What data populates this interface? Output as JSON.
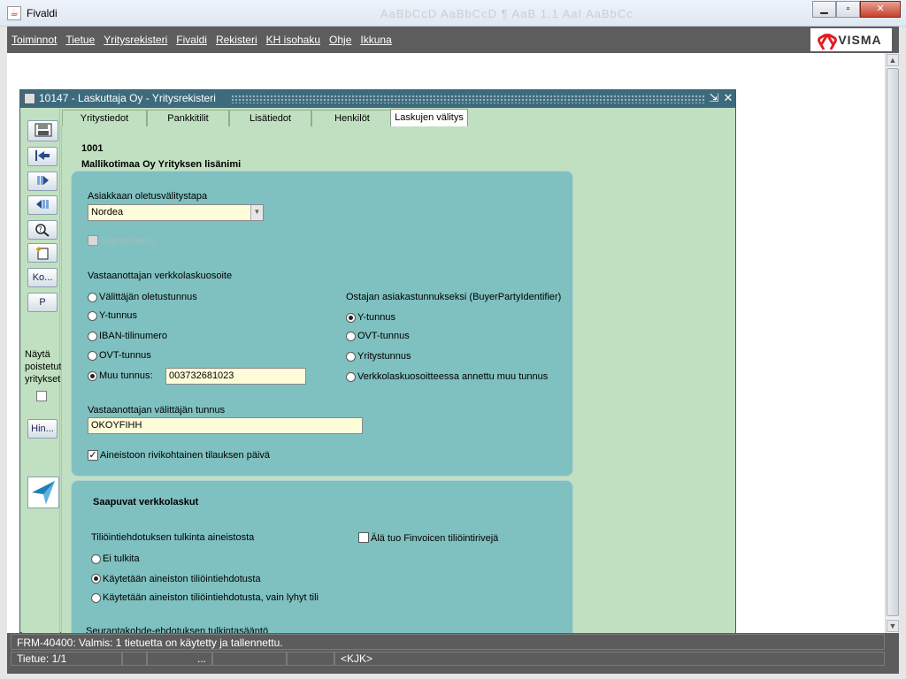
{
  "window": {
    "title": "Fivaldi",
    "icon": "java-cup-icon",
    "faded_toolbar_text": "AaBbCcD  AaBbCcD  ¶  AaB  1.1  AaI  AaBbCc"
  },
  "menu": {
    "items": [
      "Toiminnot",
      "Tietue",
      "Yritysrekisteri",
      "Fivaldi",
      "Rekisteri",
      "KH isohaku",
      "Ohje",
      "Ikkuna"
    ]
  },
  "brand": {
    "name": "VISMA",
    "color": "#e21a22"
  },
  "form": {
    "title": "10147 - Laskuttaja Oy - Yritysrekisteri",
    "tabs": [
      "Yritystiedot",
      "Pankkitilit",
      "Lisätiedot",
      "Henkilöt",
      "Laskujen välitys"
    ],
    "active_tab": "Laskujen välitys",
    "company_code": "1001",
    "company_name": "Mallikotimaa Oy Yrityksen lisänimi",
    "toolbar": {
      "ko_label": "Ko...",
      "p_label": "P",
      "show_deleted_line1": "Näytä",
      "show_deleted_line2": "poistetut",
      "show_deleted_line3": "yritykset",
      "hin_label": "Hin..."
    },
    "panel1": {
      "default_method_label": "Asiakkaan oletusvälitystapa",
      "default_method_value": "Nordea",
      "supramaksu_label": "Supramaksu",
      "address_label": "Vastaanottajan verkkolaskuosoite",
      "address_options": [
        "Välittäjän oletustunnus",
        "Y-tunnus",
        "IBAN-tilinumero",
        "OVT-tunnus",
        "Muu tunnus:"
      ],
      "address_selected": "Muu tunnus:",
      "other_id_value": "003732681023",
      "buyer_label": "Ostajan asiakastunnukseksi (BuyerPartyIdentifier)",
      "buyer_options": [
        "Y-tunnus",
        "OVT-tunnus",
        "Yritystunnus",
        "Verkkolaskuosoitteessa annettu muu tunnus"
      ],
      "buyer_selected": "Y-tunnus",
      "operator_label": "Vastaanottajan välittäjän tunnus",
      "operator_value": "OKOYFIHH",
      "row_date_label": "Aineistoon rivikohtainen tilauksen päivä",
      "row_date_checked": true
    },
    "panel2": {
      "heading": "Saapuvat verkkolaskut",
      "posting_label": "Tiliöintiehdotuksen tulkinta aineistosta",
      "posting_options": [
        "Ei tulkita",
        "Käytetään aineiston tiliöintiehdotusta",
        "Käytetään aineiston tiliöintiehdotusta, vain lyhyt tili"
      ],
      "posting_selected": "Käytetään aineiston tiliöintiehdotusta",
      "finvoice_label": "Älä tuo Finvoicen tiliöintirivejä",
      "tracking_label": "Seurantakohde-ehdotuksen tulkintasääntö"
    }
  },
  "status": {
    "message": "FRM-40400: Valmis: 1 tietuetta on käytetty ja tallennettu.",
    "record": "Tietue: 1/1",
    "dots": "...",
    "mode": "<KJK>"
  }
}
